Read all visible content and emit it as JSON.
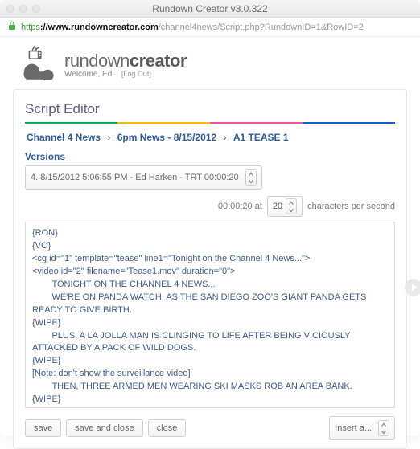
{
  "titlebar": {
    "title": "Rundown Creator v3.0.322"
  },
  "urlbar": {
    "scheme": "https",
    "host": "://www.rundowncreator.com",
    "path": "/channel4news/Script.php?RundownID=1&RowID=2"
  },
  "brand": {
    "name_thin": "rundown",
    "name_bold": "creator",
    "welcome": "Welcome, Ed!",
    "logout": "[Log Out]"
  },
  "editor": {
    "title": "Script Editor",
    "breadcrumb": {
      "p1": "Channel 4 News",
      "p2": "6pm News - 8/15/2012",
      "p3": "A1 TEASE 1"
    },
    "versions_label": "Versions",
    "version_selected": "4. 8/15/2012 5:06:55 PM - Ed Harken - TRT 00:00:20",
    "trt": {
      "time": "00:00:20 at",
      "cps": "20",
      "suffix": "characters per second"
    },
    "script": "{RON}\n{VO}\n<cg id=\"1\" template=\"tease\" line1=\"Tonight on the Channel 4 News...\">\n<video id=\"2\" filename=\"Tease1.mov\" duration=\"0\">\n        TONIGHT ON THE CHANNEL 4 NEWS...\n        WE'RE ON PANDA WATCH, AS THE SAN DIEGO ZOO'S GIANT PANDA GETS READY TO GIVE BIRTH.\n{WIPE}\n        PLUS, A LA JOLLA MAN IS CLINGING TO LIFE AFTER BEING VICIOUSLY ATTACKED BY A PACK OF WILD DOGS.\n{WIPE}\n[Note: don't show the surveillance video]\n        THEN, THREE ARMED MEN WEARING SKI MASKS ROB AN AREA BANK.\n{WIPE}\n        AND LATER, AN AQUATIC DAREDEVIL--\n        MORE VIDEO OF THIS WATERSKIING SQUIRREL.\n        THE CHANNEL 4 NEWS AT SIX STARTS NOW.\n{OPEN}",
    "buttons": {
      "save": "save",
      "save_close": "save and close",
      "close": "close",
      "insert": "Insert a..."
    }
  }
}
